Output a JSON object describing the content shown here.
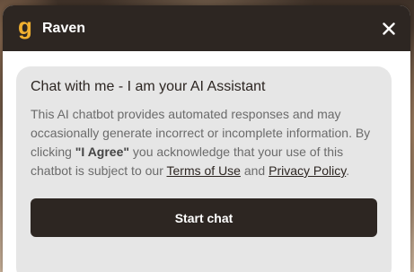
{
  "header": {
    "logo_glyph": "g",
    "title": "Raven",
    "close_icon": "close-icon",
    "close_glyph": "✕"
  },
  "card": {
    "title": "Chat with me - I am your AI Assistant",
    "disclaimer": {
      "part1": "This AI chatbot provides automated responses and may occasionally generate incorrect or incomplete information. By clicking ",
      "agree_text": "\"I Agree\"",
      "part2": " you acknowledge that your use of this chatbot is subject to our ",
      "terms_link": "Terms of Use",
      "and_text": " and ",
      "privacy_link": "Privacy Policy",
      "end": "."
    },
    "start_button": "Start chat"
  },
  "colors": {
    "header_bg": "#2d2622",
    "logo_accent": "#f0b030",
    "card_bg": "#e6e6e6",
    "button_bg": "#2d2622"
  }
}
